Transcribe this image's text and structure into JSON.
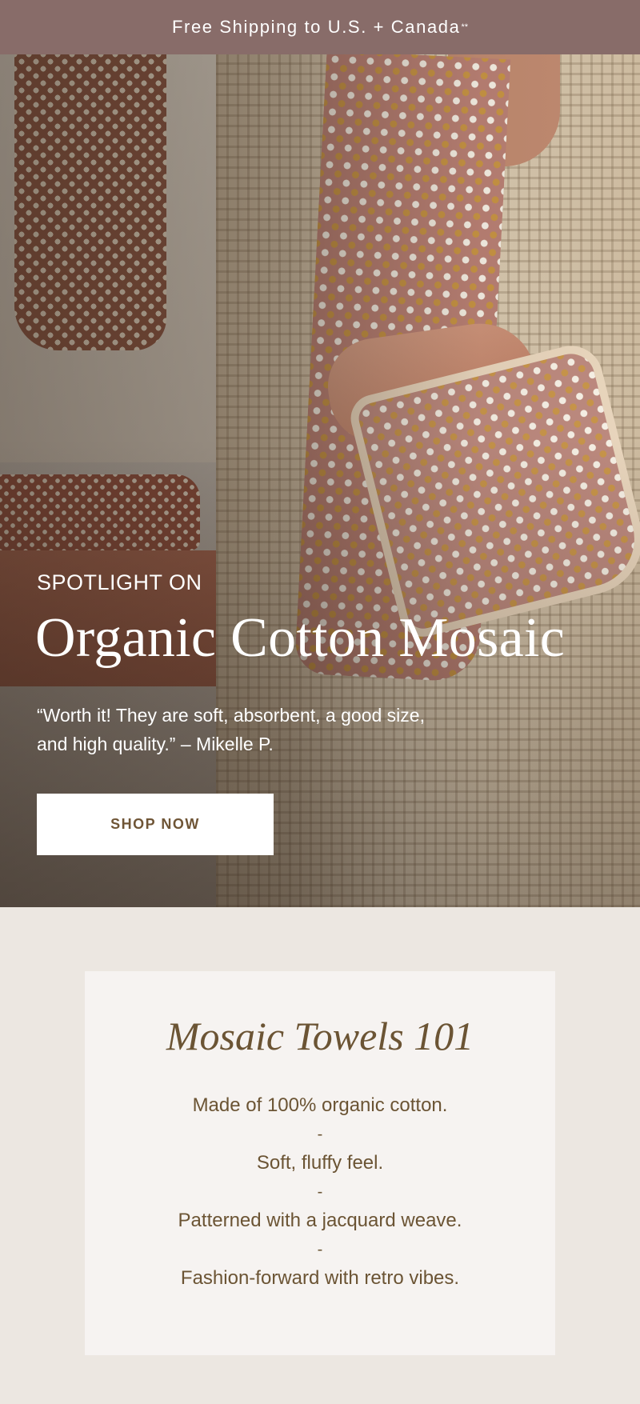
{
  "topbar": {
    "text": "Free Shipping to U.S. + Canada",
    "marker": "**"
  },
  "hero": {
    "eyebrow": "SPOTLIGHT ON",
    "title": "Organic Cotton Mosaic",
    "quote": "“Worth it! They are soft, absorbent, a good size, and high quality.” – Mikelle P.",
    "button_label": "SHOP NOW"
  },
  "card": {
    "title": "Mosaic Towels 101",
    "separator": "-",
    "features": [
      "Made of 100% organic cotton.",
      "Soft, fluffy feel.",
      "Patterned with a jacquard weave.",
      "Fashion-forward with retro vibes."
    ]
  },
  "colors": {
    "topbar_bg": "#886c69",
    "page_bg": "#ece7e1",
    "card_bg": "#f6f3f1",
    "text_brown": "#6b5434"
  }
}
